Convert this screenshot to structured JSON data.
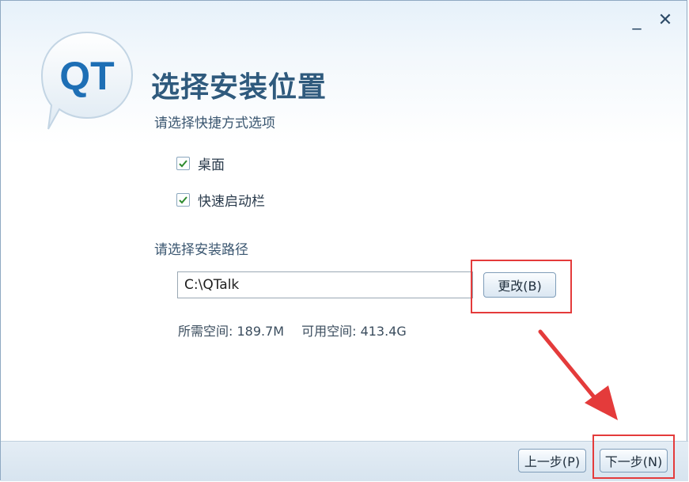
{
  "window": {
    "minimize_glyph": "_",
    "close_glyph": "✕"
  },
  "logo": {
    "text": "QT",
    "icon": "qt-speech-bubble-logo"
  },
  "header": {
    "title": "选择安装位置",
    "subtitle": "请选择快捷方式选项"
  },
  "shortcuts": {
    "items": [
      {
        "label": "桌面",
        "checked": true
      },
      {
        "label": "快速启动栏",
        "checked": true
      }
    ]
  },
  "install_path": {
    "label": "请选择安装路径",
    "value": "C:\\QTalk",
    "change_button": "更改(B)"
  },
  "space": {
    "required": "所需空间: 189.7M",
    "available": "可用空间: 413.4G"
  },
  "footer": {
    "prev_button": "上一步(P)",
    "next_button": "下一步(N)"
  },
  "colors": {
    "highlight": "#e43b3b",
    "title": "#2f5a7d",
    "logo_blue": "#1e6fb5"
  }
}
